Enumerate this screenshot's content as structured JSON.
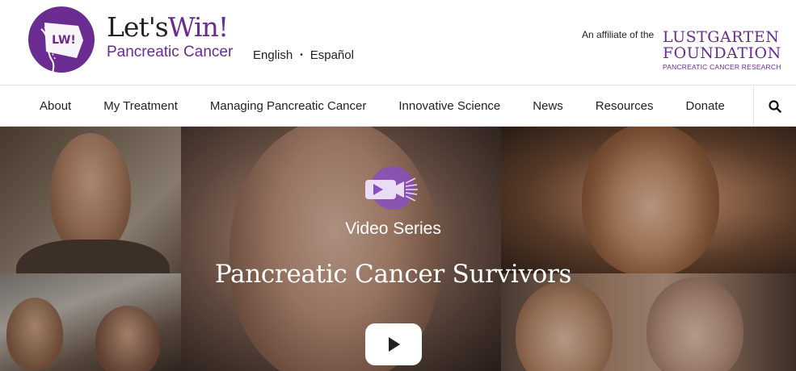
{
  "brand": {
    "logo_text": "LW!",
    "title_prefix": "Let's",
    "title_highlight": "Win!",
    "subtitle": "Pancreatic Cancer"
  },
  "language": {
    "options": [
      "English",
      "Español"
    ],
    "separator": "•"
  },
  "affiliate": {
    "label": "An affiliate of the",
    "org_line1": "LUSTGARTEN",
    "org_line2": "FOUNDATION",
    "org_line3": "PANCREATIC CANCER RESEARCH"
  },
  "nav": {
    "items": [
      "About",
      "My Treatment",
      "Managing Pancreatic Cancer",
      "Innovative Science",
      "News",
      "Resources",
      "Donate"
    ],
    "search_icon": "search-icon"
  },
  "hero": {
    "kicker": "Video Series",
    "title": "Pancreatic Cancer Survivors",
    "icon": "video-camera-icon",
    "play_icon": "play-icon"
  },
  "colors": {
    "brand_purple": "#6a2c91",
    "icon_purple": "#8a4fbf",
    "text_dark": "#222222"
  }
}
